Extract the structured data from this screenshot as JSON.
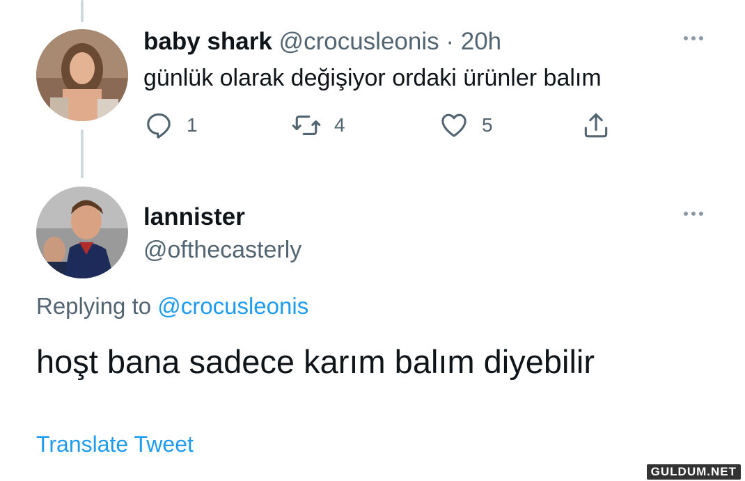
{
  "tweet1": {
    "name": "baby shark",
    "handle": "@crocusleonis",
    "separator": "·",
    "time": "20h",
    "text": "günlük olarak değişiyor ordaki ürünler balım",
    "reply_count": "1",
    "retweet_count": "4",
    "like_count": "5"
  },
  "tweet2": {
    "name": "lannister",
    "handle": "@ofthecasterly",
    "replying_prefix": "Replying to",
    "replying_to": "@crocusleonis",
    "text": "hoşt bana sadece karım balım diyebilir",
    "translate_label": "Translate Tweet"
  },
  "watermark": "GULDUM.NET",
  "colors": {
    "link": "#1d9bf0",
    "secondary_text": "#536471",
    "thread_line": "#cfd9de"
  }
}
